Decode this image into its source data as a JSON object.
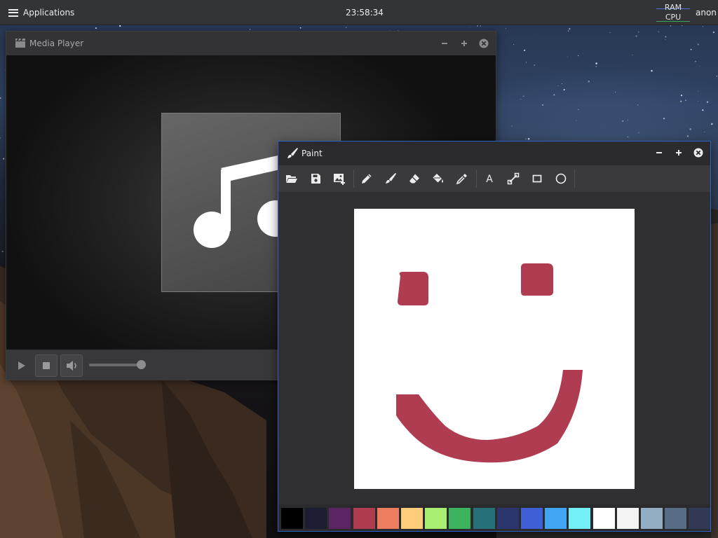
{
  "top_panel": {
    "applications_label": "Applications",
    "clock": "23:58:34",
    "sysmon": {
      "ram_label": "RAM",
      "cpu_label": "CPU"
    },
    "user": "anon"
  },
  "media_player": {
    "title": "Media Player",
    "icons": {
      "title": "film-clapper-icon",
      "minimize": "minimize-icon",
      "maximize": "maximize-icon",
      "close": "close-icon",
      "album_art": "music-note-icon",
      "play": "play-icon",
      "stop": "stop-icon",
      "volume": "volume-icon"
    }
  },
  "paint": {
    "title": "Paint",
    "icons": {
      "title": "paintbrush-icon",
      "minimize": "minimize-icon",
      "maximize": "maximize-icon",
      "close": "close-icon"
    },
    "tools": [
      {
        "name": "open",
        "icon": "folder-open-icon"
      },
      {
        "name": "save",
        "icon": "save-icon"
      },
      {
        "name": "insert-image",
        "icon": "insert-image-icon"
      },
      {
        "name": "pencil",
        "icon": "pencil-icon"
      },
      {
        "name": "brush",
        "icon": "brush-icon"
      },
      {
        "name": "eraser",
        "icon": "eraser-icon"
      },
      {
        "name": "fill",
        "icon": "paint-bucket-icon"
      },
      {
        "name": "color-picker",
        "icon": "eyedropper-icon"
      },
      {
        "name": "text",
        "icon": "text-icon",
        "glyph": "A"
      },
      {
        "name": "line",
        "icon": "line-icon"
      },
      {
        "name": "rectangle",
        "icon": "rectangle-icon"
      },
      {
        "name": "ellipse",
        "icon": "ellipse-icon"
      }
    ],
    "drawing_color": "#b03c51",
    "palette": [
      "#000000",
      "#1c1d33",
      "#5b2463",
      "#b03c51",
      "#ee7c5e",
      "#fecd7a",
      "#a8ef71",
      "#3cb45d",
      "#267179",
      "#2b356e",
      "#3f5fd6",
      "#41a5f6",
      "#72f0f5",
      "#ffffff",
      "#f3f3f3",
      "#93aec2",
      "#576c87",
      "#323955"
    ]
  },
  "colors": {
    "panel": "#333438",
    "window_accent": "#2d63c4"
  }
}
